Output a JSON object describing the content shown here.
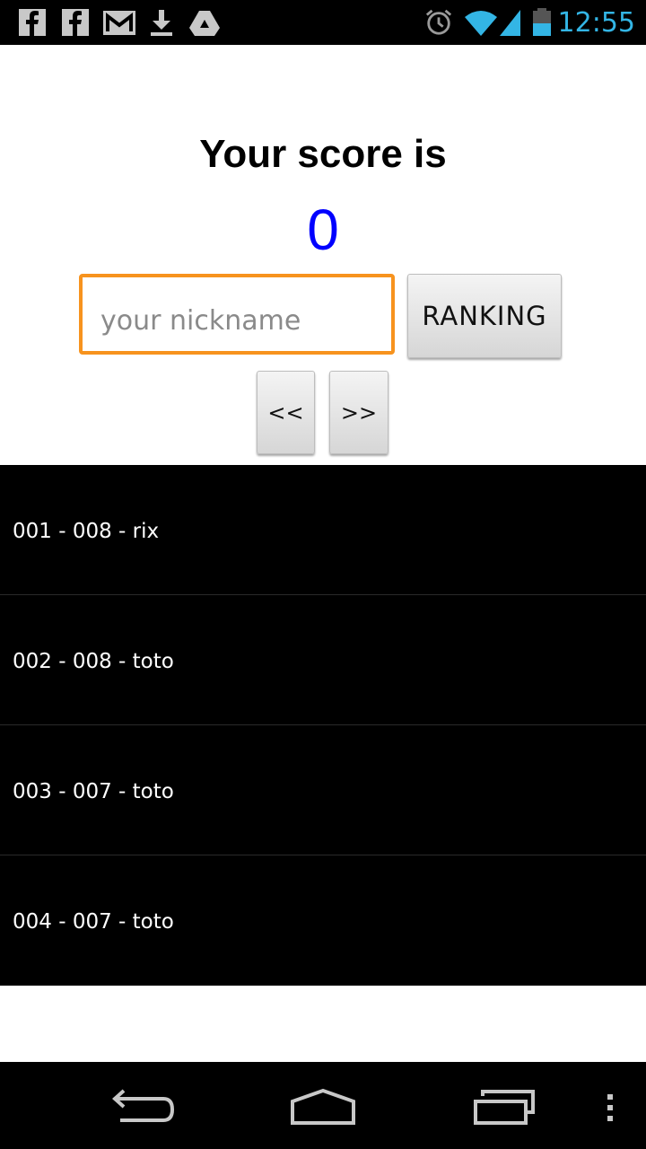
{
  "status_bar": {
    "time": "12:55",
    "left_icons": [
      "facebook-icon",
      "facebook-icon",
      "gmail-icon",
      "download-icon",
      "drive-icon"
    ],
    "right_icons": [
      "alarm-icon",
      "wifi-icon",
      "signal-icon",
      "battery-icon"
    ],
    "time_color": "#33b5e5"
  },
  "score": {
    "title": "Your score is",
    "value": "0",
    "value_color": "#0000ff"
  },
  "nickname": {
    "value": "",
    "placeholder": "your nickname",
    "border_color": "#f7931e"
  },
  "buttons": {
    "ranking": "RANKING",
    "prev": "<<",
    "next": ">>"
  },
  "ranking": {
    "rows": [
      {
        "label": "001 - 008 - rix"
      },
      {
        "label": "002 - 008 - toto"
      },
      {
        "label": "003 - 007 - toto"
      },
      {
        "label": "004 - 007 - toto"
      }
    ]
  },
  "nav_bar": {
    "icons": [
      "back-icon",
      "home-icon",
      "recent-apps-icon",
      "overflow-menu-icon"
    ]
  }
}
